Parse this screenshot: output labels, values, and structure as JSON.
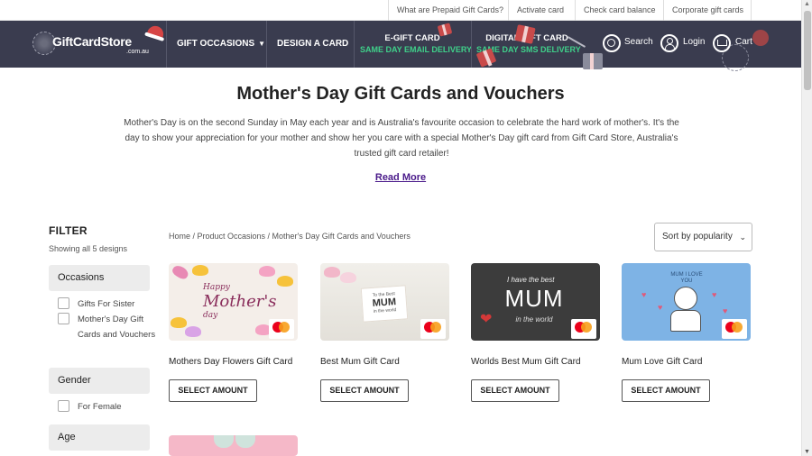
{
  "utility_links": [
    "What are Prepaid Gift Cards?",
    "Activate card",
    "Check card balance",
    "Corporate gift cards"
  ],
  "logo": {
    "text": "GiftCardStore",
    "sub": ".com.au"
  },
  "nav": {
    "gift_occasions": "GIFT OCCASIONS",
    "design_card": "DESIGN A CARD",
    "egift_title": "E-GIFT CARD",
    "egift_sub": "SAME DAY EMAIL DELIVERY",
    "digital_title": "DIGITAL GIFT CARD",
    "digital_sub": "SAME DAY SMS DELIVERY",
    "search": "Search",
    "login": "Login",
    "cart": "Cart"
  },
  "hero": {
    "title": "Mother's Day Gift Cards and Vouchers",
    "intro": "Mother's Day is on the second Sunday in May each year and is Australia's favourite occasion to celebrate the hard work of mother's. It's the day to show your appreciation for your mother and show her you care with a special Mother's Day gift card from Gift Card Store, Australia's trusted gift card retailer!",
    "read_more": "Read More"
  },
  "filter": {
    "heading": "FILTER",
    "showing": "Showing all 5 designs",
    "occasions_label": "Occasions",
    "occasions": [
      "Gifts For Sister",
      "Mother's Day Gift Cards and Vouchers"
    ],
    "gender_label": "Gender",
    "gender": [
      "For Female"
    ],
    "age_label": "Age"
  },
  "breadcrumb": "Home / Product Occasions / Mother's Day Gift Cards and Vouchers",
  "sort": {
    "selected": "Sort by popularity"
  },
  "products": [
    {
      "name": "Mothers Day Flowers Gift Card",
      "button": "SELECT AMOUNT",
      "art": {
        "line1": "Happy",
        "line2": "Mother's",
        "line3": "day"
      }
    },
    {
      "name": "Best Mum Gift Card",
      "button": "SELECT AMOUNT",
      "art": {
        "line1": "To the Best",
        "line2": "MUM",
        "line3": "in the world"
      }
    },
    {
      "name": "Worlds Best Mum Gift Card",
      "button": "SELECT AMOUNT",
      "art": {
        "line1": "I have the best",
        "line2": "MUM",
        "line3": "in the world"
      }
    },
    {
      "name": "Mum Love Gift Card",
      "button": "SELECT AMOUNT",
      "art": {
        "line1": "MUM I LOVE YOU"
      }
    }
  ],
  "colors": {
    "nav_bg": "#3a3c4f",
    "accent_green": "#3fd08a",
    "read_more": "#4a1a8a"
  },
  "icons": [
    "search-icon",
    "user-icon",
    "cart-icon",
    "chevron-down-icon"
  ]
}
